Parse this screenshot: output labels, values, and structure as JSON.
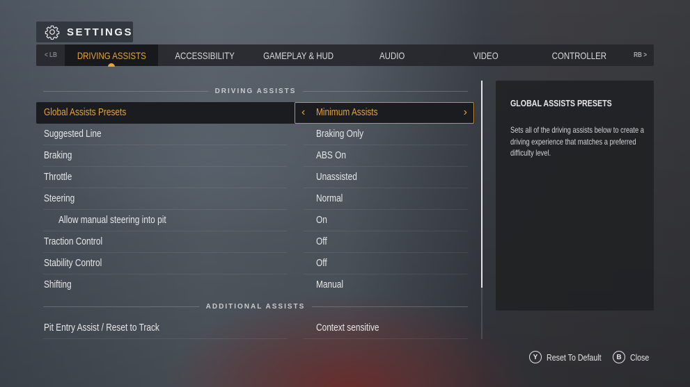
{
  "header": {
    "title": "SETTINGS",
    "icon": "gear-icon"
  },
  "tabs": {
    "prev_hint": "< LB",
    "next_hint": "RB >",
    "items": [
      {
        "label": "DRIVING ASSISTS",
        "active": true
      },
      {
        "label": "ACCESSIBILITY",
        "active": false
      },
      {
        "label": "GAMEPLAY & HUD",
        "active": false
      },
      {
        "label": "AUDIO",
        "active": false
      },
      {
        "label": "VIDEO",
        "active": false
      },
      {
        "label": "CONTROLLER",
        "active": false
      }
    ]
  },
  "sections": [
    {
      "title": "DRIVING ASSISTS",
      "rows": [
        {
          "label": "Global Assists Presets",
          "value": "Minimum Assists",
          "selected": true
        },
        {
          "label": "Suggested Line",
          "value": "Braking Only"
        },
        {
          "label": "Braking",
          "value": "ABS On"
        },
        {
          "label": "Throttle",
          "value": "Unassisted"
        },
        {
          "label": "Steering",
          "value": "Normal"
        },
        {
          "label": "Allow manual steering into pit",
          "value": "On",
          "indented": true
        },
        {
          "label": "Traction Control",
          "value": "Off"
        },
        {
          "label": "Stability Control",
          "value": "Off"
        },
        {
          "label": "Shifting",
          "value": "Manual"
        }
      ]
    },
    {
      "title": "ADDITIONAL ASSISTS",
      "rows": [
        {
          "label": "Pit Entry Assist / Reset to Track",
          "value": "Context sensitive"
        }
      ]
    }
  ],
  "selector_icons": {
    "prev": "‹",
    "next": "›"
  },
  "info_panel": {
    "title": "GLOBAL ASSISTS PRESETS",
    "body": "Sets all of the driving assists below to create a driving experience that matches a preferred difficulty level."
  },
  "footer": {
    "reset": {
      "glyph": "Y",
      "label": "Reset To Default"
    },
    "close": {
      "glyph": "B",
      "label": "Close"
    }
  },
  "colors": {
    "accent": "#e2a43b",
    "panel": "#202124",
    "text": "#e6e6e6"
  }
}
